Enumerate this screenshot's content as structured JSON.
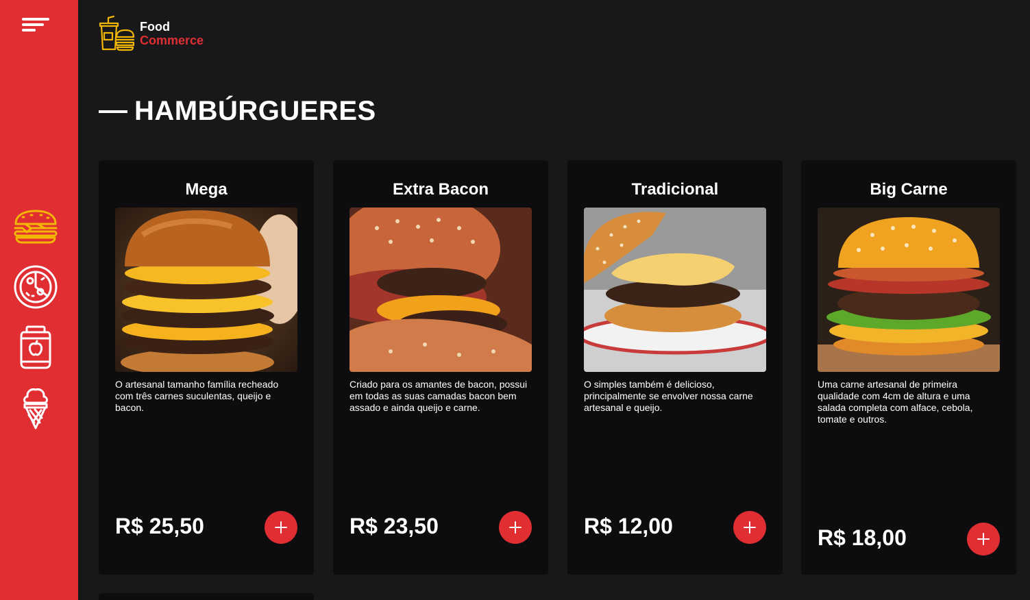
{
  "app": {
    "logo_line1": "Food",
    "logo_line2": "Commerce"
  },
  "colors": {
    "accent": "#e02e33",
    "background": "#18181b",
    "card": "#0d0d10",
    "logo_icon": "#f2b705"
  },
  "sidebar": {
    "menu_icon": "menu-lines-icon",
    "categories": [
      {
        "icon": "burger-icon",
        "active": true
      },
      {
        "icon": "pizza-icon",
        "active": false
      },
      {
        "icon": "drink-jar-icon",
        "active": false
      },
      {
        "icon": "ice-cream-icon",
        "active": false
      }
    ]
  },
  "section": {
    "title": "HAMBÚRGUERES"
  },
  "products": [
    {
      "name": "Mega",
      "description": "O artesanal tamanho família recheado com três carnes suculentas, queijo e bacon.",
      "price": "R$ 25,50",
      "add_label": "+"
    },
    {
      "name": "Extra Bacon",
      "description": "Criado para os amantes de bacon, possui em todas as suas camadas bacon bem assado e ainda queijo e carne.",
      "price": "R$ 23,50",
      "add_label": "+"
    },
    {
      "name": "Tradicional",
      "description": "O simples também é delicioso, principalmente se envolver nossa carne artesanal e queijo.",
      "price": "R$ 12,00",
      "add_label": "+"
    },
    {
      "name": "Big Carne",
      "description": "Uma carne artesanal de primeira qualidade com 4cm de altura e uma salada completa com alface, cebola, tomate e outros.",
      "price": "R$ 18,00",
      "add_label": "+"
    }
  ]
}
